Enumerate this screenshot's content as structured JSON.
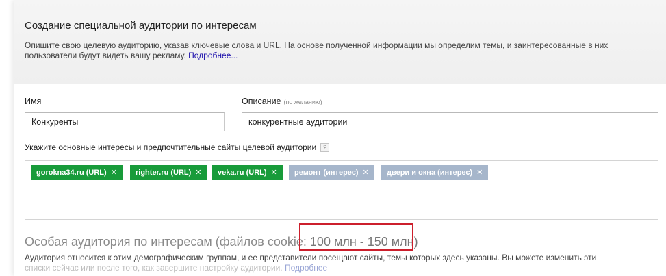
{
  "header": {
    "title": "Создание специальной аудитории по интересам",
    "description": "Опишите свою целевую аудиторию, указав ключевые слова и URL. На основе полученной информации мы определим темы, и заинтересованные в них пользователи будут видеть вашу рекламу.",
    "more_link": "Подробнее..."
  },
  "form": {
    "name_label": "Имя",
    "name_value": "Конкуренты",
    "description_label": "Описание",
    "description_optional": "(по желанию)",
    "description_value": "конкурентные аудитории",
    "interests_label": "Укажите основные интересы и предпочтительные сайты целевой аудитории",
    "help_glyph": "?"
  },
  "tags": [
    {
      "label": "gorokna34.ru (URL)",
      "type": "url",
      "color": "#189b3a"
    },
    {
      "label": "righter.ru (URL)",
      "type": "url",
      "color": "#189b3a"
    },
    {
      "label": "veka.ru (URL)",
      "type": "url",
      "color": "#189b3a"
    },
    {
      "label": "ремонт (интерес)",
      "type": "interest",
      "color": "#a6b6cb"
    },
    {
      "label": "двери и окна (интерес)",
      "type": "interest",
      "color": "#a6b6cb"
    }
  ],
  "tag_remove_glyph": "✕",
  "audience": {
    "title_prefix": "Особая аудитория по интересам (файлов cookie:",
    "size": "100 млн - 150 млн)",
    "highlight_color": "#cc1f2c",
    "description_line1": "Аудитория относится к этим демографическим группам, и ее представители посещают сайты, темы которых здесь указаны. Вы можете изменить эти",
    "description_line2": "списки сейчас или после того, как завершите настройку аудитории.",
    "more_link": "Подробнее"
  },
  "colors": {
    "header_bg": "#f1f1f1",
    "url_tag": "#189b3a",
    "interest_tag": "#a6b6cb",
    "link": "#1a0dab"
  }
}
